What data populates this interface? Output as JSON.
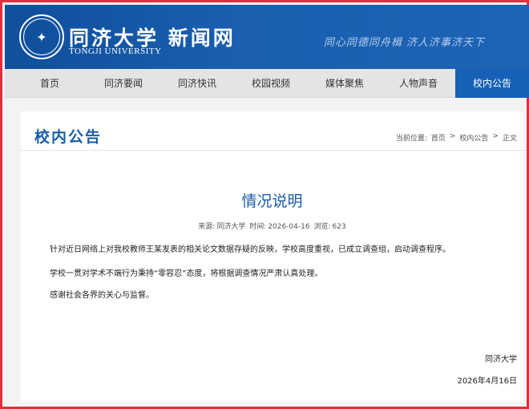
{
  "header": {
    "logo_icon": "university-seal-icon",
    "site_title": "同济大学 新闻网",
    "site_subtitle": "TONGJI UNIVERSITY",
    "motto": "同心同德同舟楫 济人济事济天下",
    "colors": {
      "header_blue": "#1a5fb0",
      "frame_red": "#e0303d",
      "accent_blue": "#1760b7"
    }
  },
  "nav": {
    "items": [
      {
        "label": "首页"
      },
      {
        "label": "同济要闻"
      },
      {
        "label": "同济快讯"
      },
      {
        "label": "校园视频"
      },
      {
        "label": "媒体聚焦"
      },
      {
        "label": "人物声音"
      },
      {
        "label": "校内公告"
      }
    ],
    "active_index": 6
  },
  "section": {
    "title": "校内公告"
  },
  "breadcrumb": {
    "prefix": "当前位置:",
    "items": [
      "首页",
      "校内公告",
      "正文"
    ],
    "separator": ">"
  },
  "article": {
    "title": "情况说明",
    "source_label": "来源:",
    "source": "同济大学",
    "time_label": "时间:",
    "time": "2026-04-16",
    "views_label": "浏览:",
    "views": "623",
    "paragraphs": [
      "针对近日网络上对我校教师王某发表的相关论文数据存疑的反映，学校高度重视，已成立调查组，启动调查程序。",
      "学校一贯对学术不端行为秉持“零容忍”态度，将根据调查情况严肃认真处理。",
      "感谢社会各界的关心与监督。"
    ],
    "signature": "同济大学",
    "date": "2026年4月16日"
  }
}
